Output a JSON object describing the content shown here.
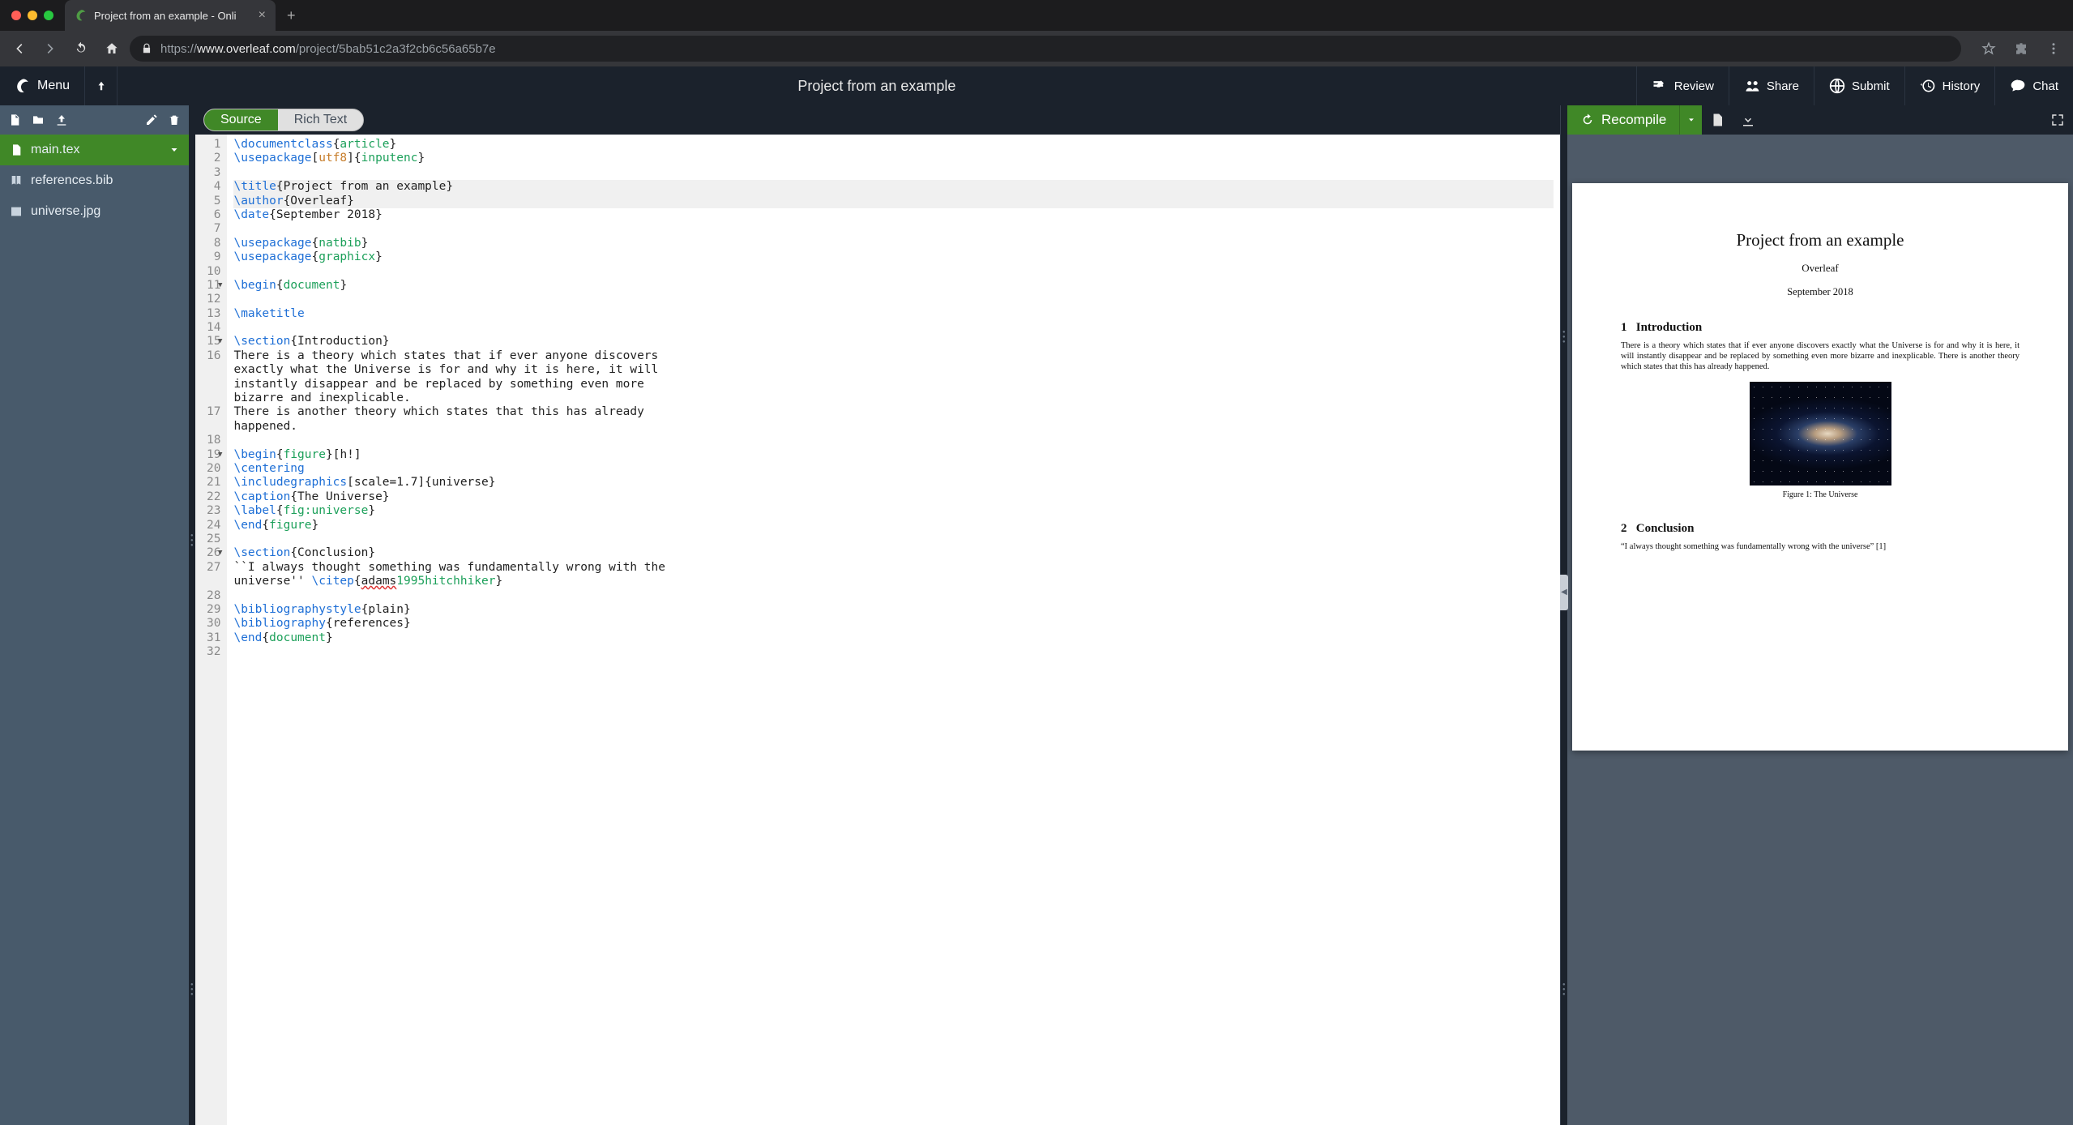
{
  "browser": {
    "tab_title": "Project from an example - Onli",
    "url_prefix": "https://",
    "url_host": "www.overleaf.com",
    "url_path": "/project/5bab51c2a3f2cb6c56a65b7e"
  },
  "toolbar": {
    "menu_label": "Menu",
    "project_title": "Project from an example",
    "items": [
      {
        "key": "review",
        "label": "Review"
      },
      {
        "key": "share",
        "label": "Share"
      },
      {
        "key": "submit",
        "label": "Submit"
      },
      {
        "key": "history",
        "label": "History"
      },
      {
        "key": "chat",
        "label": "Chat"
      }
    ]
  },
  "files": [
    {
      "name": "main.tex",
      "icon": "file-icon",
      "active": true,
      "expandable": true
    },
    {
      "name": "references.bib",
      "icon": "book-icon",
      "active": false,
      "expandable": false
    },
    {
      "name": "universe.jpg",
      "icon": "image-icon",
      "active": false,
      "expandable": false
    }
  ],
  "editor": {
    "tabs": {
      "source": "Source",
      "richtext": "Rich Text"
    },
    "active_tab": "source",
    "lines": [
      {
        "n": 1,
        "fold": false,
        "hl": false,
        "tokens": [
          [
            "cmd",
            "\\documentclass"
          ],
          [
            "",
            "{"
          ],
          [
            "arg",
            "article"
          ],
          [
            "",
            "}"
          ]
        ]
      },
      {
        "n": 2,
        "fold": false,
        "hl": false,
        "tokens": [
          [
            "cmd",
            "\\usepackage"
          ],
          [
            "",
            "["
          ],
          [
            "opt",
            "utf8"
          ],
          [
            "",
            "]{"
          ],
          [
            "arg",
            "inputenc"
          ],
          [
            "",
            "}"
          ]
        ]
      },
      {
        "n": 3,
        "fold": false,
        "hl": false,
        "tokens": []
      },
      {
        "n": 4,
        "fold": false,
        "hl": true,
        "tokens": [
          [
            "cmd",
            "\\title"
          ],
          [
            "",
            "{Project from an example}"
          ]
        ]
      },
      {
        "n": 5,
        "fold": false,
        "hl": true,
        "tokens": [
          [
            "cmd",
            "\\author"
          ],
          [
            "",
            "{Overleaf}"
          ]
        ]
      },
      {
        "n": 6,
        "fold": false,
        "hl": false,
        "tokens": [
          [
            "cmd",
            "\\date"
          ],
          [
            "",
            "{September 2018}"
          ]
        ]
      },
      {
        "n": 7,
        "fold": false,
        "hl": false,
        "tokens": []
      },
      {
        "n": 8,
        "fold": false,
        "hl": false,
        "tokens": [
          [
            "cmd",
            "\\usepackage"
          ],
          [
            "",
            "{"
          ],
          [
            "arg",
            "natbib"
          ],
          [
            "",
            "}"
          ]
        ]
      },
      {
        "n": 9,
        "fold": false,
        "hl": false,
        "tokens": [
          [
            "cmd",
            "\\usepackage"
          ],
          [
            "",
            "{"
          ],
          [
            "arg",
            "graphicx"
          ],
          [
            "",
            "}"
          ]
        ]
      },
      {
        "n": 10,
        "fold": false,
        "hl": false,
        "tokens": []
      },
      {
        "n": 11,
        "fold": true,
        "hl": false,
        "tokens": [
          [
            "cmd",
            "\\begin"
          ],
          [
            "",
            "{"
          ],
          [
            "arg",
            "document"
          ],
          [
            "",
            "}"
          ]
        ]
      },
      {
        "n": 12,
        "fold": false,
        "hl": false,
        "tokens": []
      },
      {
        "n": 13,
        "fold": false,
        "hl": false,
        "tokens": [
          [
            "cmd",
            "\\maketitle"
          ]
        ]
      },
      {
        "n": 14,
        "fold": false,
        "hl": false,
        "tokens": []
      },
      {
        "n": 15,
        "fold": true,
        "hl": false,
        "tokens": [
          [
            "cmd",
            "\\section"
          ],
          [
            "",
            "{Introduction}"
          ]
        ]
      },
      {
        "n": 16,
        "fold": false,
        "hl": false,
        "wrap": 4,
        "text": "There is a theory which states that if ever anyone discovers exactly what the Universe is for and why it is here, it will instantly disappear and be replaced by something even more bizarre and inexplicable."
      },
      {
        "n": 17,
        "fold": false,
        "hl": false,
        "wrap": 2,
        "text": "There is another theory which states that this has already happened."
      },
      {
        "n": 18,
        "fold": false,
        "hl": false,
        "tokens": []
      },
      {
        "n": 19,
        "fold": true,
        "hl": false,
        "tokens": [
          [
            "cmd",
            "\\begin"
          ],
          [
            "",
            "{"
          ],
          [
            "arg",
            "figure"
          ],
          [
            "",
            "}[h!]"
          ]
        ]
      },
      {
        "n": 20,
        "fold": false,
        "hl": false,
        "tokens": [
          [
            "cmd",
            "\\centering"
          ]
        ]
      },
      {
        "n": 21,
        "fold": false,
        "hl": false,
        "tokens": [
          [
            "cmd",
            "\\includegraphics"
          ],
          [
            "",
            "[scale=1.7]{universe}"
          ]
        ]
      },
      {
        "n": 22,
        "fold": false,
        "hl": false,
        "tokens": [
          [
            "cmd",
            "\\caption"
          ],
          [
            "",
            "{The Universe}"
          ]
        ]
      },
      {
        "n": 23,
        "fold": false,
        "hl": false,
        "tokens": [
          [
            "cmd",
            "\\label"
          ],
          [
            "",
            "{"
          ],
          [
            "arg",
            "fig:universe"
          ],
          [
            "",
            "}"
          ]
        ]
      },
      {
        "n": 24,
        "fold": false,
        "hl": false,
        "tokens": [
          [
            "cmd",
            "\\end"
          ],
          [
            "",
            "{"
          ],
          [
            "arg",
            "figure"
          ],
          [
            "",
            "}"
          ]
        ]
      },
      {
        "n": 25,
        "fold": false,
        "hl": false,
        "tokens": []
      },
      {
        "n": 26,
        "fold": true,
        "hl": false,
        "tokens": [
          [
            "cmd",
            "\\section"
          ],
          [
            "",
            "{Conclusion}"
          ]
        ]
      },
      {
        "n": 27,
        "fold": false,
        "hl": false,
        "wrap": 2,
        "tokens": [
          [
            "",
            "``I always thought something was fundamentally wrong with the universe'' "
          ],
          [
            "cmd",
            "\\citep"
          ],
          [
            "",
            "{"
          ],
          [
            "err",
            "adams"
          ],
          [
            "arg",
            "1995hitchhiker"
          ],
          [
            "",
            "}"
          ]
        ]
      },
      {
        "n": 28,
        "fold": false,
        "hl": false,
        "tokens": []
      },
      {
        "n": 29,
        "fold": false,
        "hl": false,
        "tokens": [
          [
            "cmd",
            "\\bibliographystyle"
          ],
          [
            "",
            "{plain}"
          ]
        ]
      },
      {
        "n": 30,
        "fold": false,
        "hl": false,
        "tokens": [
          [
            "cmd",
            "\\bibliography"
          ],
          [
            "",
            "{references}"
          ]
        ]
      },
      {
        "n": 31,
        "fold": false,
        "hl": false,
        "tokens": [
          [
            "cmd",
            "\\end"
          ],
          [
            "",
            "{"
          ],
          [
            "arg",
            "document"
          ],
          [
            "",
            "}"
          ]
        ]
      },
      {
        "n": 32,
        "fold": false,
        "hl": false,
        "tokens": []
      }
    ]
  },
  "pdf": {
    "recompile_label": "Recompile",
    "doc": {
      "title": "Project from an example",
      "author": "Overleaf",
      "date": "September 2018",
      "sec1_num": "1",
      "sec1_title": "Introduction",
      "sec1_body": "There is a theory which states that if ever anyone discovers exactly what the Universe is for and why it is here, it will instantly disappear and be replaced by something even more bizarre and inexplicable. There is another theory which states that this has already happened.",
      "fig_caption": "Figure 1: The Universe",
      "sec2_num": "2",
      "sec2_title": "Conclusion",
      "sec2_quote": "“I always thought something was fundamentally wrong with the universe”  [1]"
    }
  }
}
